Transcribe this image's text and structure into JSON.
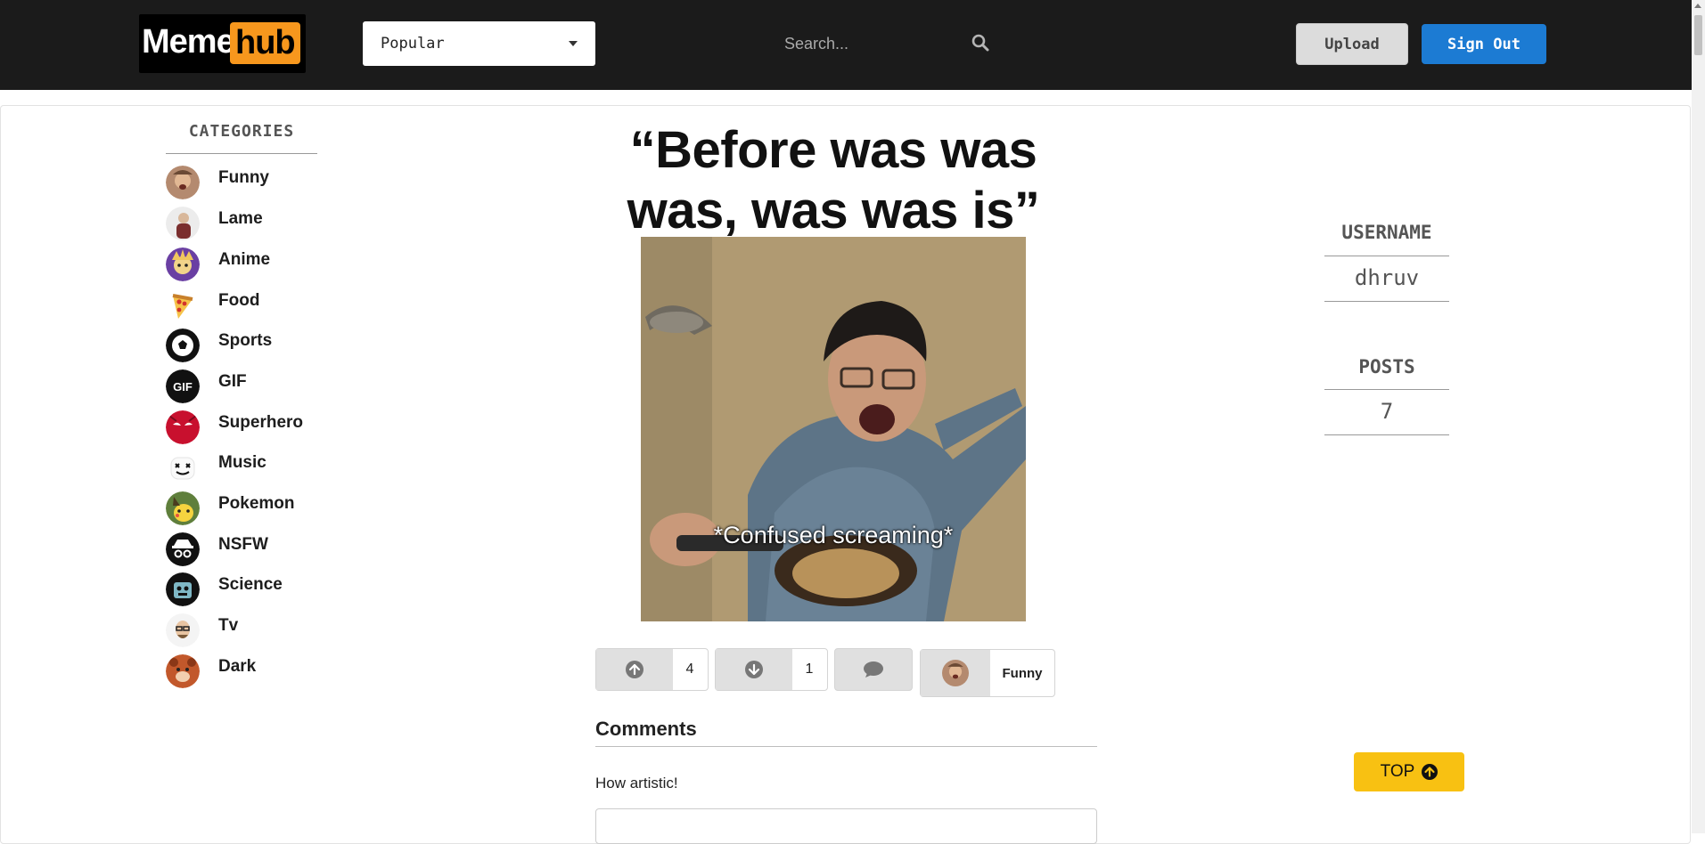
{
  "navbar": {
    "logo": {
      "part1": "Meme",
      "part2": "hub"
    },
    "sort_select": {
      "value": "Popular"
    },
    "search": {
      "placeholder": "Search..."
    },
    "upload_label": "Upload",
    "signout_label": "Sign Out"
  },
  "sidebar": {
    "title": "CATEGORIES",
    "items": [
      {
        "label": "Funny",
        "icon": "funny-avatar-icon"
      },
      {
        "label": "Lame",
        "icon": "lame-avatar-icon"
      },
      {
        "label": "Anime",
        "icon": "anime-avatar-icon"
      },
      {
        "label": "Food",
        "icon": "pizza-icon"
      },
      {
        "label": "Sports",
        "icon": "soccer-ball-icon"
      },
      {
        "label": "GIF",
        "icon": "gif-icon"
      },
      {
        "label": "Superhero",
        "icon": "superhero-mask-icon"
      },
      {
        "label": "Music",
        "icon": "marshmello-icon"
      },
      {
        "label": "Pokemon",
        "icon": "pikachu-icon"
      },
      {
        "label": "NSFW",
        "icon": "spy-icon"
      },
      {
        "label": "Science",
        "icon": "robot-icon"
      },
      {
        "label": "Tv",
        "icon": "heisenberg-icon"
      },
      {
        "label": "Dark",
        "icon": "dark-bear-icon"
      }
    ]
  },
  "post": {
    "title": "“Before was was was, was was is”",
    "image_caption": "*Confused screaming*",
    "upvotes": "4",
    "downvotes": "1",
    "category": "Funny"
  },
  "comments": {
    "title": "Comments",
    "items": [
      {
        "text": "How artistic!"
      }
    ]
  },
  "profile": {
    "username_label": "USERNAME",
    "username": "dhruv",
    "posts_label": "POSTS",
    "posts_count": "7"
  },
  "top_button": {
    "label": "TOP"
  },
  "colors": {
    "navbar_bg": "#1b1b1b",
    "logo_accent": "#f7971d",
    "signout_blue": "#1c7bd3",
    "top_yellow": "#f8c112"
  }
}
